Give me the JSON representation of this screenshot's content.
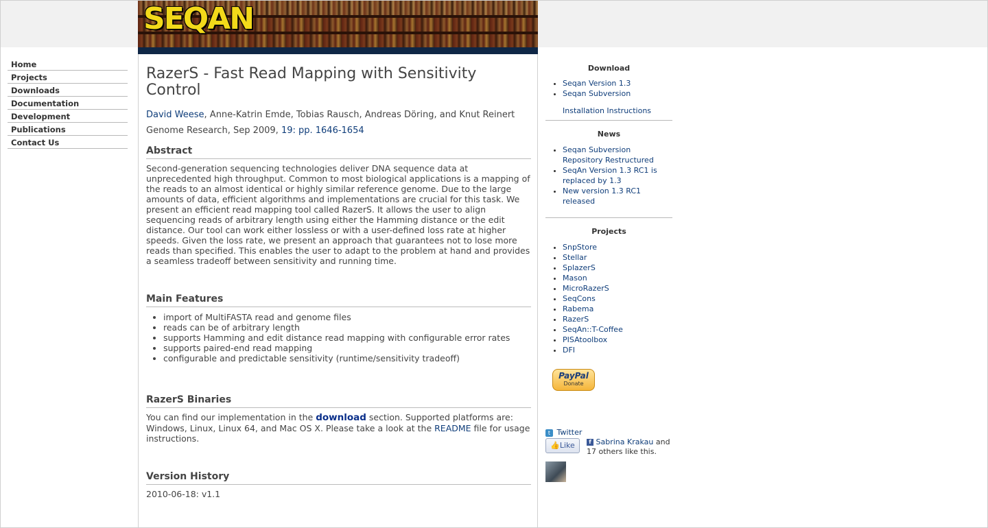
{
  "nav": {
    "items": [
      {
        "label": "Home"
      },
      {
        "label": "Projects"
      },
      {
        "label": "Downloads"
      },
      {
        "label": "Documentation"
      },
      {
        "label": "Development"
      },
      {
        "label": "Publications"
      },
      {
        "label": "Contact Us"
      }
    ]
  },
  "banner": {
    "logo_text": "SEQAN"
  },
  "article": {
    "title": "RazerS - Fast Read Mapping with Sensitivity Control",
    "first_author": "David Weese",
    "other_authors": ", Anne-Katrin Emde, Tobias Rausch, Andreas Döring, and Knut Reinert",
    "journal": "Genome Research, Sep 2009, ",
    "pages_link": "19: pp. 1646-1654",
    "abstract_heading": "Abstract",
    "abstract": "Second-generation sequencing technologies deliver DNA sequence data at unprecedented high throughput. Common to most biological applications is a mapping of the reads to an almost identical or highly similar reference genome. Due to the large amounts of data, efficient algorithms and implementations are crucial for this task. We present an efficient read mapping tool called RazerS. It allows the user to align sequencing reads of arbitrary length using either the Hamming distance or the edit distance. Our tool can work either lossless or with a user-defined loss rate at higher speeds. Given the loss rate, we present an approach that guarantees not to lose more reads than specified. This enables the user to adapt to the problem at hand and provides a seamless tradeoff between sensitivity and running time.",
    "features_heading": "Main Features",
    "features": [
      "import of MultiFASTA read and genome files",
      "reads can be of arbitrary length",
      "supports Hamming and edit distance read mapping with configurable error rates",
      "supports paired-end read mapping",
      "configurable and predictable sensitivity (runtime/sensitivity tradeoff)"
    ],
    "binaries_heading": "RazerS Binaries",
    "binaries_pre": "You can find our implementation in the ",
    "binaries_link": "download",
    "binaries_mid": " section. Supported platforms are: Windows, Linux, Linux 64, and Mac OS X. Please take a look at the ",
    "readme_link": "README",
    "binaries_post": " file for usage instructions.",
    "history_heading": "Version History",
    "history_first": "2010-06-18: v1.1"
  },
  "sidebar": {
    "download_heading": "Download",
    "download_items": [
      "Seqan Version 1.3",
      "Seqan Subversion"
    ],
    "install_link": "Installation Instructions",
    "news_heading": "News",
    "news_items": [
      "Seqan Subversion Repository Restructured",
      "SeqAn Version 1.3 RC1 is replaced by 1.3",
      "New version 1.3 RC1 released"
    ],
    "projects_heading": "Projects",
    "project_items": [
      "SnpStore",
      "Stellar",
      "SplazerS",
      "Mason",
      "MicroRazerS",
      "SeqCons",
      "Rabema",
      "RazerS",
      "SeqAn::T-Coffee",
      "PISAtoolbox",
      "DFI"
    ],
    "paypal_label": "PayPal",
    "paypal_sub": "Donate",
    "twitter_label": "Twitter",
    "like_label": "Like",
    "like_person": "Sabrina Krakau",
    "like_rest": " and 17 others like this."
  }
}
